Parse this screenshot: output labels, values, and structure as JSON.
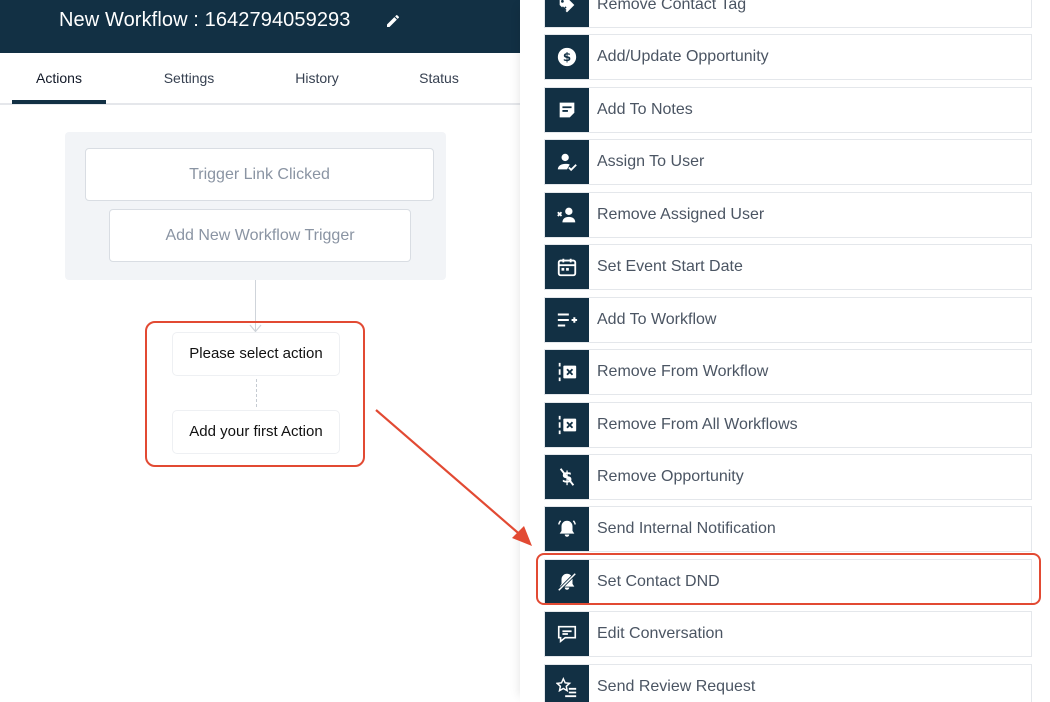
{
  "header": {
    "title": "New Workflow : 1642794059293"
  },
  "tabs": [
    {
      "label": "Actions"
    },
    {
      "label": "Settings"
    },
    {
      "label": "History"
    },
    {
      "label": "Status"
    }
  ],
  "canvas": {
    "trigger_clicked": "Trigger Link Clicked",
    "add_trigger": "Add New Workflow Trigger",
    "select_action": "Please select action",
    "add_first_action": "Add your first Action"
  },
  "actions": [
    {
      "label": "Remove Contact Tag",
      "icon": "tag-remove-icon"
    },
    {
      "label": "Add/Update Opportunity",
      "icon": "dollar-icon"
    },
    {
      "label": "Add To Notes",
      "icon": "note-icon"
    },
    {
      "label": "Assign To User",
      "icon": "user-check-icon"
    },
    {
      "label": "Remove Assigned User",
      "icon": "user-remove-icon"
    },
    {
      "label": "Set Event Start Date",
      "icon": "calendar-icon"
    },
    {
      "label": "Add To Workflow",
      "icon": "list-add-icon"
    },
    {
      "label": "Remove From Workflow",
      "icon": "workflow-remove-icon"
    },
    {
      "label": "Remove From All Workflows",
      "icon": "workflow-remove-icon"
    },
    {
      "label": "Remove Opportunity",
      "icon": "dollar-off-icon"
    },
    {
      "label": "Send Internal Notification",
      "icon": "bell-icon"
    },
    {
      "label": "Set Contact DND",
      "icon": "bell-off-icon"
    },
    {
      "label": "Edit Conversation",
      "icon": "chat-icon"
    },
    {
      "label": "Send Review Request",
      "icon": "star-list-icon"
    }
  ],
  "colors": {
    "header_bg": "#123044",
    "highlight": "#e24a33"
  }
}
